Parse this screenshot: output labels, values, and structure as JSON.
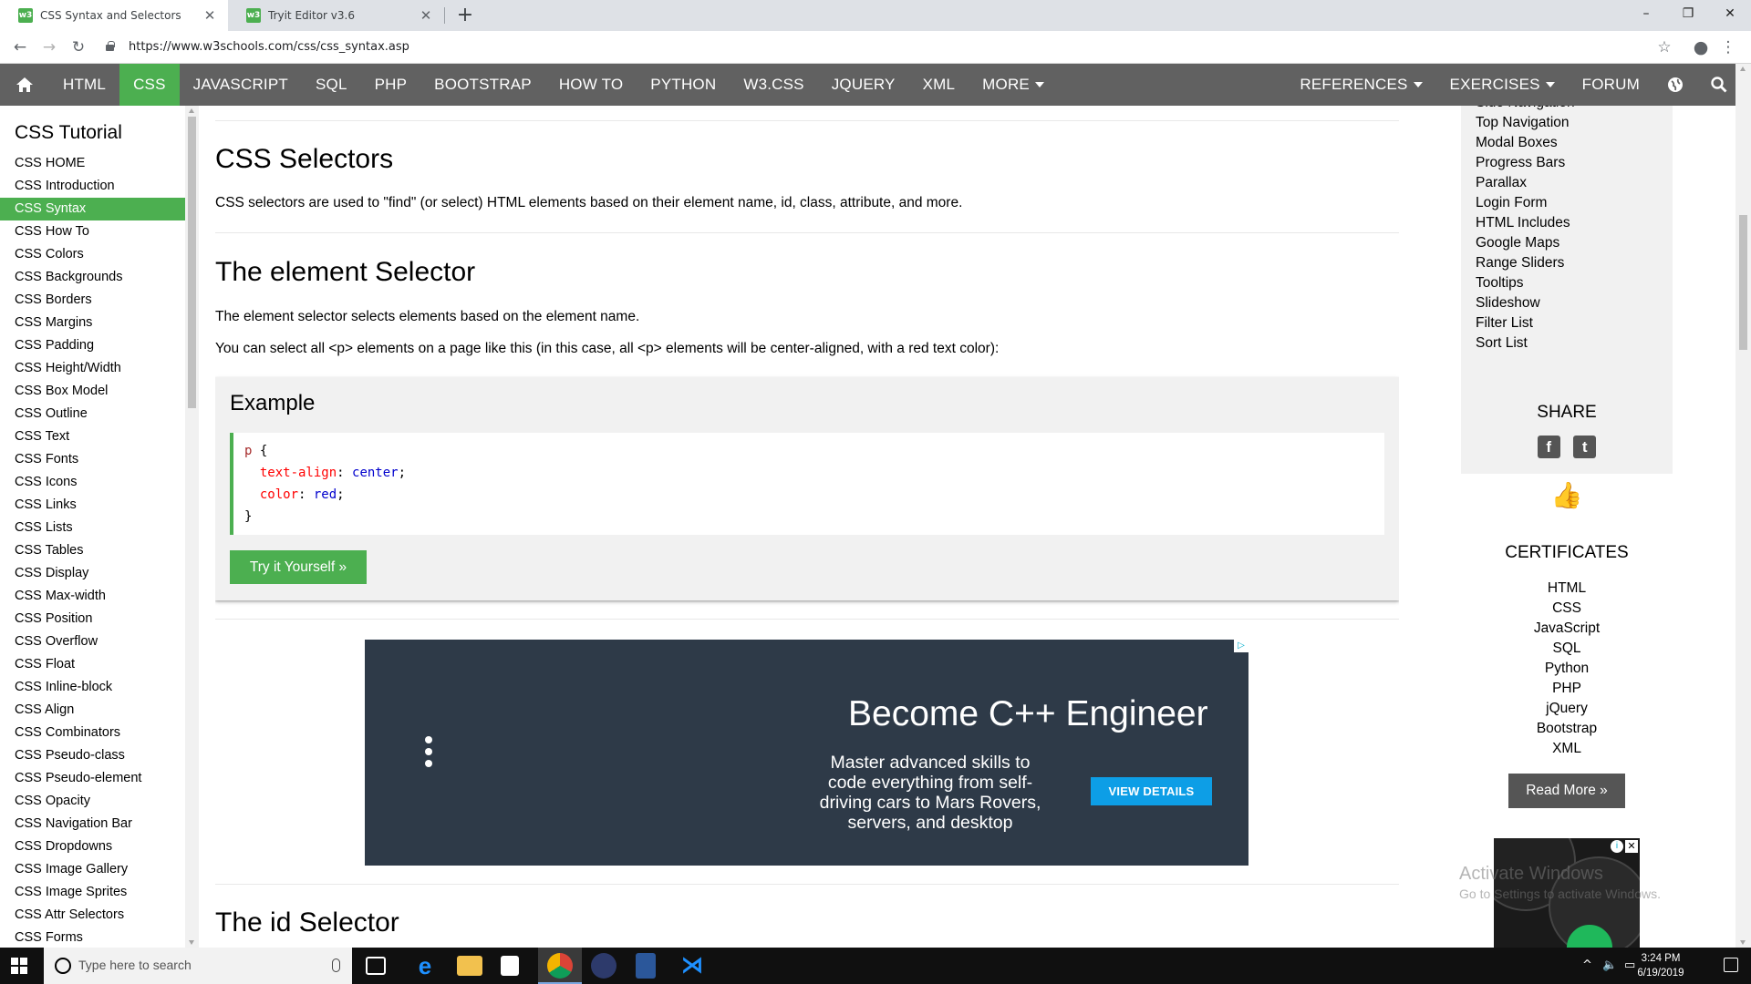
{
  "browser": {
    "tabs": [
      {
        "title": "CSS Syntax and Selectors",
        "active": true
      },
      {
        "title": "Tryit Editor v3.6",
        "active": false
      }
    ],
    "url": "https://www.w3schools.com/css/css_syntax.asp",
    "window_controls": {
      "minimize": "–",
      "maximize": "❐",
      "close": "✕"
    },
    "new_tab": "+",
    "close_tab": "✕"
  },
  "topnav": {
    "left_items": [
      "HTML",
      "CSS",
      "JAVASCRIPT",
      "SQL",
      "PHP",
      "BOOTSTRAP",
      "HOW TO",
      "PYTHON",
      "W3.CSS",
      "JQUERY",
      "XML",
      "MORE"
    ],
    "right_items": [
      "REFERENCES",
      "EXERCISES",
      "FORUM"
    ],
    "active_item": "CSS",
    "colors": {
      "bar": "#616161",
      "active": "#4caf50"
    }
  },
  "sidebar": {
    "heading": "CSS Tutorial",
    "items": [
      "CSS HOME",
      "CSS Introduction",
      "CSS Syntax",
      "CSS How To",
      "CSS Colors",
      "CSS Backgrounds",
      "CSS Borders",
      "CSS Margins",
      "CSS Padding",
      "CSS Height/Width",
      "CSS Box Model",
      "CSS Outline",
      "CSS Text",
      "CSS Fonts",
      "CSS Icons",
      "CSS Links",
      "CSS Lists",
      "CSS Tables",
      "CSS Display",
      "CSS Max-width",
      "CSS Position",
      "CSS Overflow",
      "CSS Float",
      "CSS Inline-block",
      "CSS Align",
      "CSS Combinators",
      "CSS Pseudo-class",
      "CSS Pseudo-element",
      "CSS Opacity",
      "CSS Navigation Bar",
      "CSS Dropdowns",
      "CSS Image Gallery",
      "CSS Image Sprites",
      "CSS Attr Selectors",
      "CSS Forms"
    ],
    "active_item": "CSS Syntax"
  },
  "main": {
    "selectors_heading": "CSS Selectors",
    "selectors_text": "CSS selectors are used to \"find\" (or select) HTML elements based on their element name, id, class, attribute, and more.",
    "element_heading": "The element Selector",
    "element_text_1": "The element selector selects elements based on the element name.",
    "element_text_2": "You can select all <p> elements on a page like this (in this case, all <p> elements will be center-aligned, with a red text color):",
    "example": {
      "title": "Example",
      "code": {
        "selector": "p",
        "open": " {",
        "rules": [
          {
            "property": "text-align",
            "value": "center"
          },
          {
            "property": "color",
            "value": "red"
          }
        ],
        "close": "}"
      },
      "try_button": "Try it Yourself »"
    },
    "id_heading": "The id Selector"
  },
  "ad": {
    "headline": "Become C++ Engineer",
    "body": "Master advanced skills to code everything from self-driving cars to Mars Rovers, servers, and desktop",
    "cta": "VIEW DETAILS",
    "ad_choices": "▷"
  },
  "right_column": {
    "links": [
      "Side Navigation",
      "Top Navigation",
      "Modal Boxes",
      "Progress Bars",
      "Parallax",
      "Login Form",
      "HTML Includes",
      "Google Maps",
      "Range Sliders",
      "Tooltips",
      "Slideshow",
      "Filter List",
      "Sort List"
    ],
    "share_title": "SHARE",
    "share_icons": [
      {
        "name": "facebook-icon",
        "glyph": "f"
      },
      {
        "name": "twitter-icon",
        "glyph": "t"
      }
    ],
    "like_icon": "👍",
    "certificates_title": "CERTIFICATES",
    "certificates": [
      "HTML",
      "CSS",
      "JavaScript",
      "SQL",
      "Python",
      "PHP",
      "jQuery",
      "Bootstrap",
      "XML"
    ],
    "read_more": "Read More »",
    "watermark_line1": "Activate Windows",
    "watermark_line2": "Go to Settings to activate Windows."
  },
  "taskbar": {
    "search_placeholder": "Type here to search",
    "time": "3:24 PM",
    "date": "6/19/2019"
  }
}
